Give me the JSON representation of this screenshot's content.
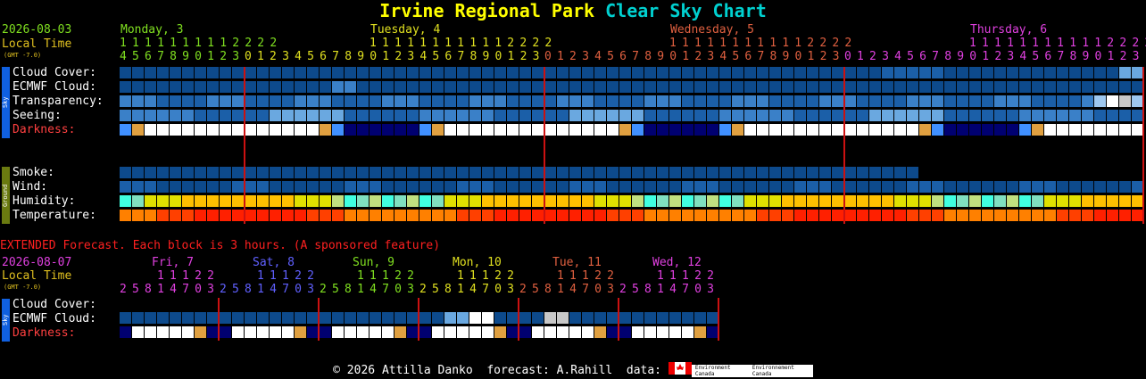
{
  "title": {
    "park": "Irvine Regional Park",
    "chart": "Clear Sky Chart"
  },
  "header": {
    "date": "2026-08-03",
    "local_time": "Local Time",
    "gmt": "(GMT -7.0)",
    "days": [
      {
        "label": "Monday, 3",
        "color": "#80e020"
      },
      {
        "label": "Tuesday, 4",
        "color": "#e0e020"
      },
      {
        "label": "Wednesday, 5",
        "color": "#e06040"
      },
      {
        "label": "Thursday, 6",
        "color": "#e040e0"
      }
    ],
    "hour_tens": [
      "1111111112222",
      "111111111112222",
      "111111111112222",
      "111111111112222"
    ],
    "hour_ones": [
      "4567890123",
      "012345678901234567890123",
      "012345678901234567890123",
      "012345678901234567890123"
    ]
  },
  "sky_rows": [
    "Cloud Cover:",
    "ECMWF Cloud:",
    "Transparency:",
    "Seeing:",
    "Darkness:"
  ],
  "ground_rows": [
    "Smoke:",
    "Wind:",
    "Humidity:",
    "Temperature:"
  ],
  "side_labels": {
    "sky": "Sky",
    "ground": "Ground"
  },
  "extended": {
    "caption": "EXTENDED Forecast. Each block is 3 hours. (A sponsored feature)",
    "date": "2026-08-07",
    "local_time": "Local Time",
    "gmt": "(GMT -7.0)",
    "days": [
      {
        "label": "Fri, 7",
        "color": "#e040e0"
      },
      {
        "label": "Sat, 8",
        "color": "#6060ff"
      },
      {
        "label": "Sun, 9",
        "color": "#80e020"
      },
      {
        "label": "Mon, 10",
        "color": "#e0e020"
      },
      {
        "label": "Tue, 11",
        "color": "#e06040"
      },
      {
        "label": "Wed, 12",
        "color": "#e040e0"
      }
    ],
    "hour_tens": "11122",
    "hour_ones": "25814703",
    "rows": [
      "Cloud Cover:",
      "ECMWF Cloud:",
      "Darkness:"
    ]
  },
  "footer": {
    "copyright": "© 2026 Attilla Danko  forecast: A.Rahill  data:",
    "logo1": "Environment Canada",
    "logo2": "Environnement Canada"
  },
  "colors": {
    "label": "#ffffff",
    "darkness_label": "#ff4040",
    "marker": "#cc1111",
    "caption": "#ff2020"
  }
}
